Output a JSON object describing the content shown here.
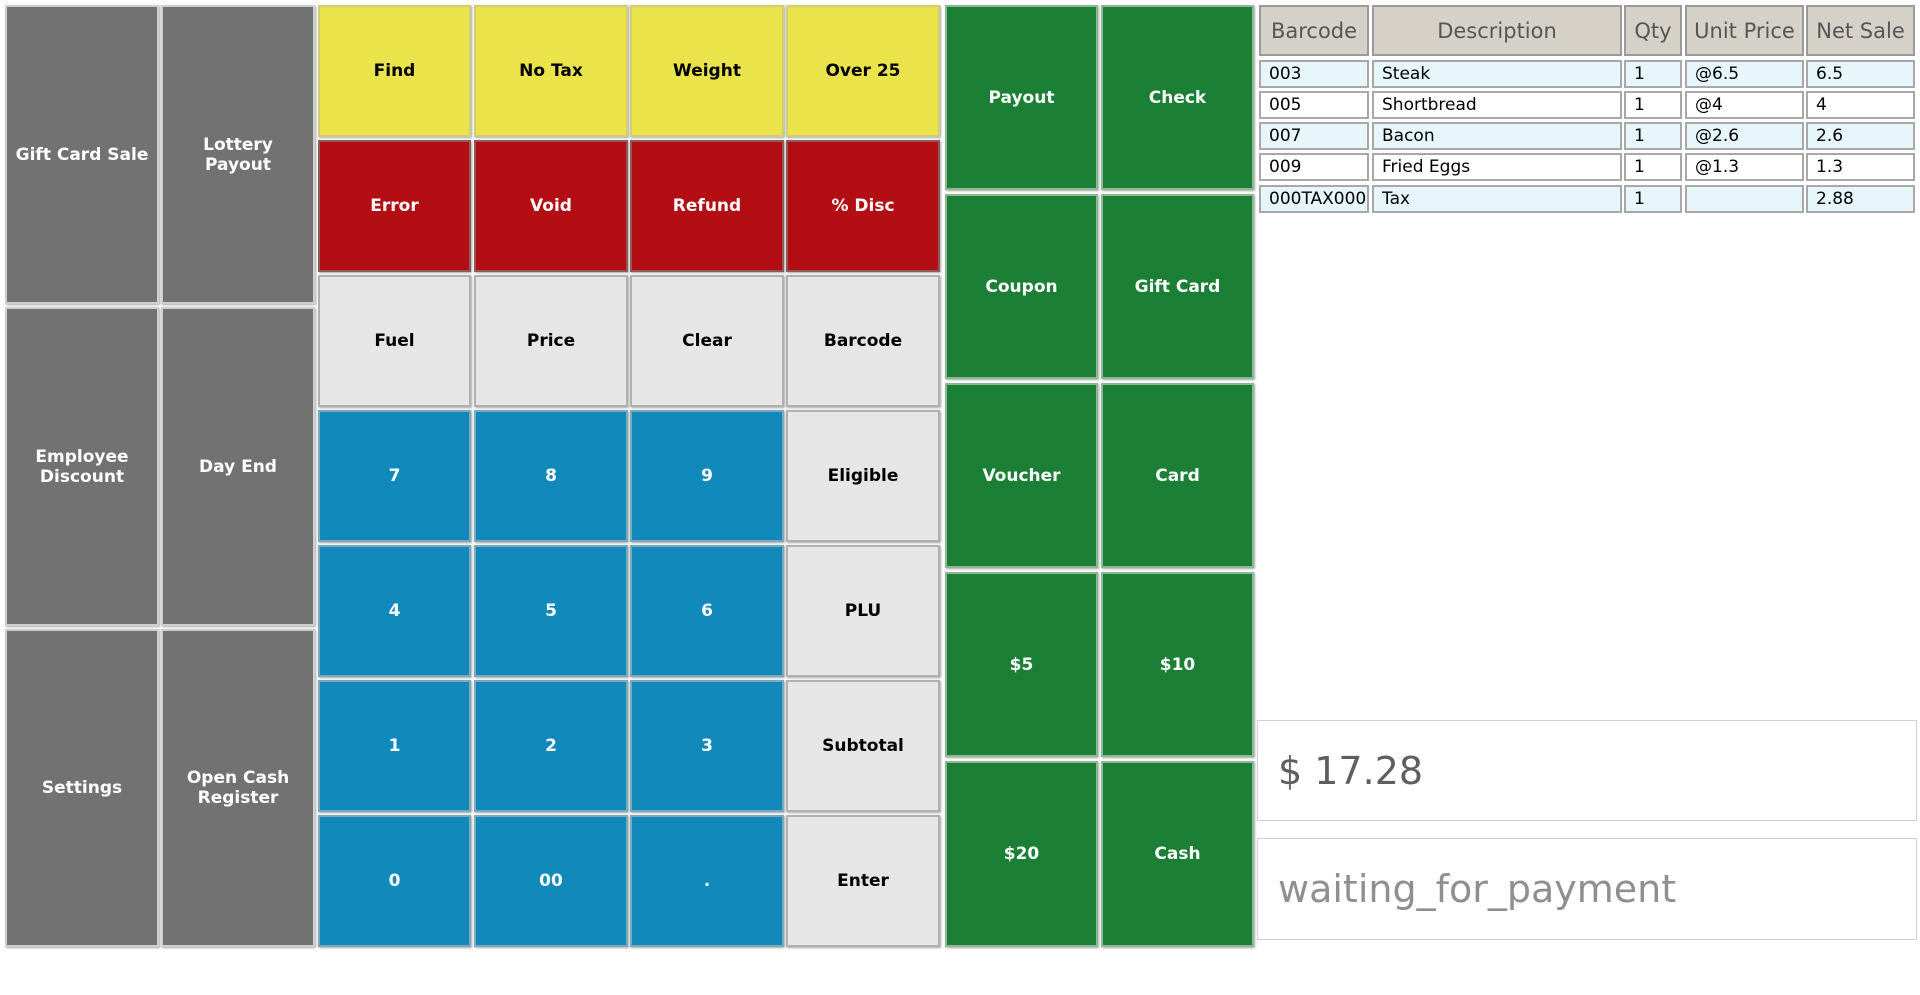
{
  "function_keys": {
    "gift_card_sale": "Gift Card Sale",
    "lottery_payout": "Lottery Payout",
    "employee_discount": "Employee Discount",
    "day_end": "Day End",
    "settings": "Settings",
    "open_cash_register": "Open Cash Register"
  },
  "keypad": {
    "find": "Find",
    "no_tax": "No Tax",
    "weight": "Weight",
    "over_25": "Over 25",
    "error": "Error",
    "void": "Void",
    "refund": "Refund",
    "pct_disc": "% Disc",
    "fuel": "Fuel",
    "price": "Price",
    "clear": "Clear",
    "barcode": "Barcode",
    "d7": "7",
    "d8": "8",
    "d9": "9",
    "eligible": "Eligible",
    "d4": "4",
    "d5": "5",
    "d6": "6",
    "plu": "PLU",
    "d1": "1",
    "d2": "2",
    "d3": "3",
    "subtotal": "Subtotal",
    "d0": "0",
    "d00": "00",
    "dot": ".",
    "enter": "Enter"
  },
  "tender": {
    "payout": "Payout",
    "check": "Check",
    "coupon": "Coupon",
    "gift_card": "Gift Card",
    "voucher": "Voucher",
    "card": "Card",
    "five": "$5",
    "ten": "$10",
    "twenty": "$20",
    "cash": "Cash"
  },
  "table": {
    "headers": {
      "barcode": "Barcode",
      "description": "Description",
      "qty": "Qty",
      "unit_price": "Unit Price",
      "net_sale": "Net Sale"
    },
    "rows": [
      {
        "barcode": "003",
        "description": "Steak",
        "qty": "1",
        "unit_price": "@6.5",
        "net_sale": "6.5"
      },
      {
        "barcode": "005",
        "description": "Shortbread",
        "qty": "1",
        "unit_price": "@4",
        "net_sale": "4"
      },
      {
        "barcode": "007",
        "description": "Bacon",
        "qty": "1",
        "unit_price": "@2.6",
        "net_sale": "2.6"
      },
      {
        "barcode": "009",
        "description": "Fried Eggs",
        "qty": "1",
        "unit_price": "@1.3",
        "net_sale": "1.3"
      },
      {
        "barcode": "000TAX000",
        "description": "Tax",
        "qty": "1",
        "unit_price": "",
        "net_sale": "2.88"
      }
    ]
  },
  "total": {
    "amount": "$ 17.28"
  },
  "status": {
    "text": "waiting_for_payment"
  },
  "colors": {
    "function_key": "#727272",
    "modifier_key": "#ebe34a",
    "correction_key": "#b30e14",
    "control_key": "#e6e6e6",
    "digit_key": "#1189bb",
    "tender_key": "#1b8035"
  }
}
